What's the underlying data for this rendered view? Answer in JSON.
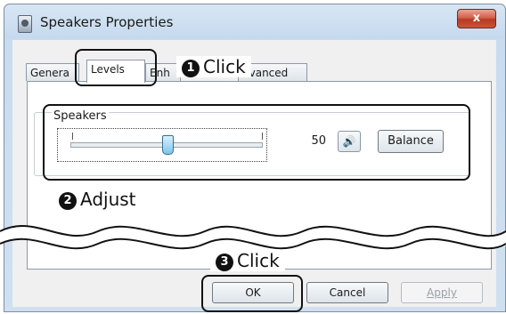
{
  "window": {
    "title": "Speakers Properties",
    "close_glyph": "x",
    "icon": "speaker-device-icon"
  },
  "tabs": [
    {
      "label": "Genera"
    },
    {
      "label": "Levels"
    },
    {
      "label": "Enh"
    },
    {
      "label": "dvanced"
    }
  ],
  "levels": {
    "group_label": "Speakers",
    "volume_value": "50",
    "volume_fraction": 0.5,
    "mute_icon": "speaker-icon",
    "balance_label": "Balance"
  },
  "buttons": {
    "ok": "OK",
    "cancel": "Cancel",
    "apply": "Apply"
  },
  "annotations": {
    "step1": {
      "number": "1",
      "text": "Click"
    },
    "step2": {
      "number": "2",
      "text": "Adjust"
    },
    "step3": {
      "number": "3",
      "text": "Click"
    }
  },
  "colors": {
    "close_red": "#c9553a",
    "title_bar": "#c6daee",
    "slider_thumb": "#7cc4ea"
  }
}
